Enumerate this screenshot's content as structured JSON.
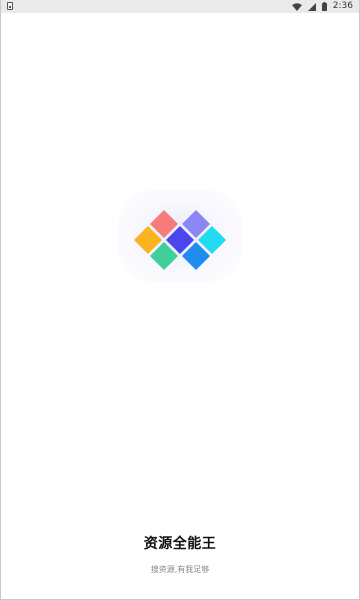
{
  "status_bar": {
    "time": "2:36",
    "icons": [
      "app-notification-icon",
      "wifi-icon",
      "signal-icon",
      "battery-icon"
    ]
  },
  "splash": {
    "app_name": "资源全能王",
    "slogan": "搜资源,有我足够",
    "logo_icon": "app-logo-icon",
    "colors": {
      "tile_red": "#f77b7b",
      "tile_purple": "#8b86f2",
      "tile_yellow": "#fbb320",
      "tile_center": "#4b45ee",
      "tile_cyan": "#21dcf0",
      "tile_green": "#3fcf99",
      "tile_blue": "#1f8cf0"
    }
  }
}
